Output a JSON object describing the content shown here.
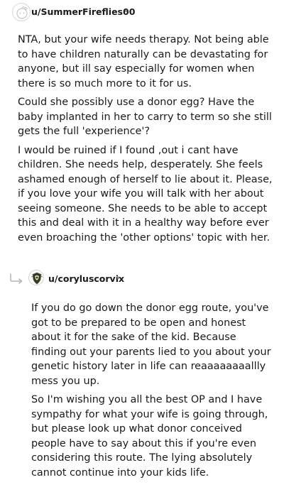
{
  "comment1": {
    "username": "u/SummerFireflies00",
    "separator": "•",
    "avatar_icon": "reddit-default-avatar-icon",
    "paragraphs": [
      "NTA, but your wife needs therapy. Not being able to have children naturally can be devastating for anyone, but ill say especially for women when there is so much more to it for us.",
      "Could she possibly use a donor egg? Have the baby implanted in her to carry to term so she still gets the full 'experience'?",
      "I would be ruined if I found ,out i cant have children. She needs help, desperately. She feels ashamed enough of herself to lie about it. Please, if you love your wife you will talk with her about seeing someone. She needs to be able to accept this and deal with it in a healthy way before ever even broaching the 'other options' topic with her."
    ]
  },
  "comment2": {
    "username": "u/coryluscorvix",
    "separator": "•",
    "reply_icon": "reply-arrow-icon",
    "avatar_icon": "crest-avatar-icon",
    "paragraphs": [
      "If you do go down the donor egg route, you've got to be prepared to be open and honest about it for the sake of the kid. Because finding out your parents lied to you about your genetic history later in life can reaaaaaaaallly mess you up.",
      "So I'm wishing you all the best OP and I have sympathy for what your wife is going through, but please look up what donor conceived people have to say about this if you're even considering this route. The lying absolutely cannot continue into your kids life."
    ]
  }
}
